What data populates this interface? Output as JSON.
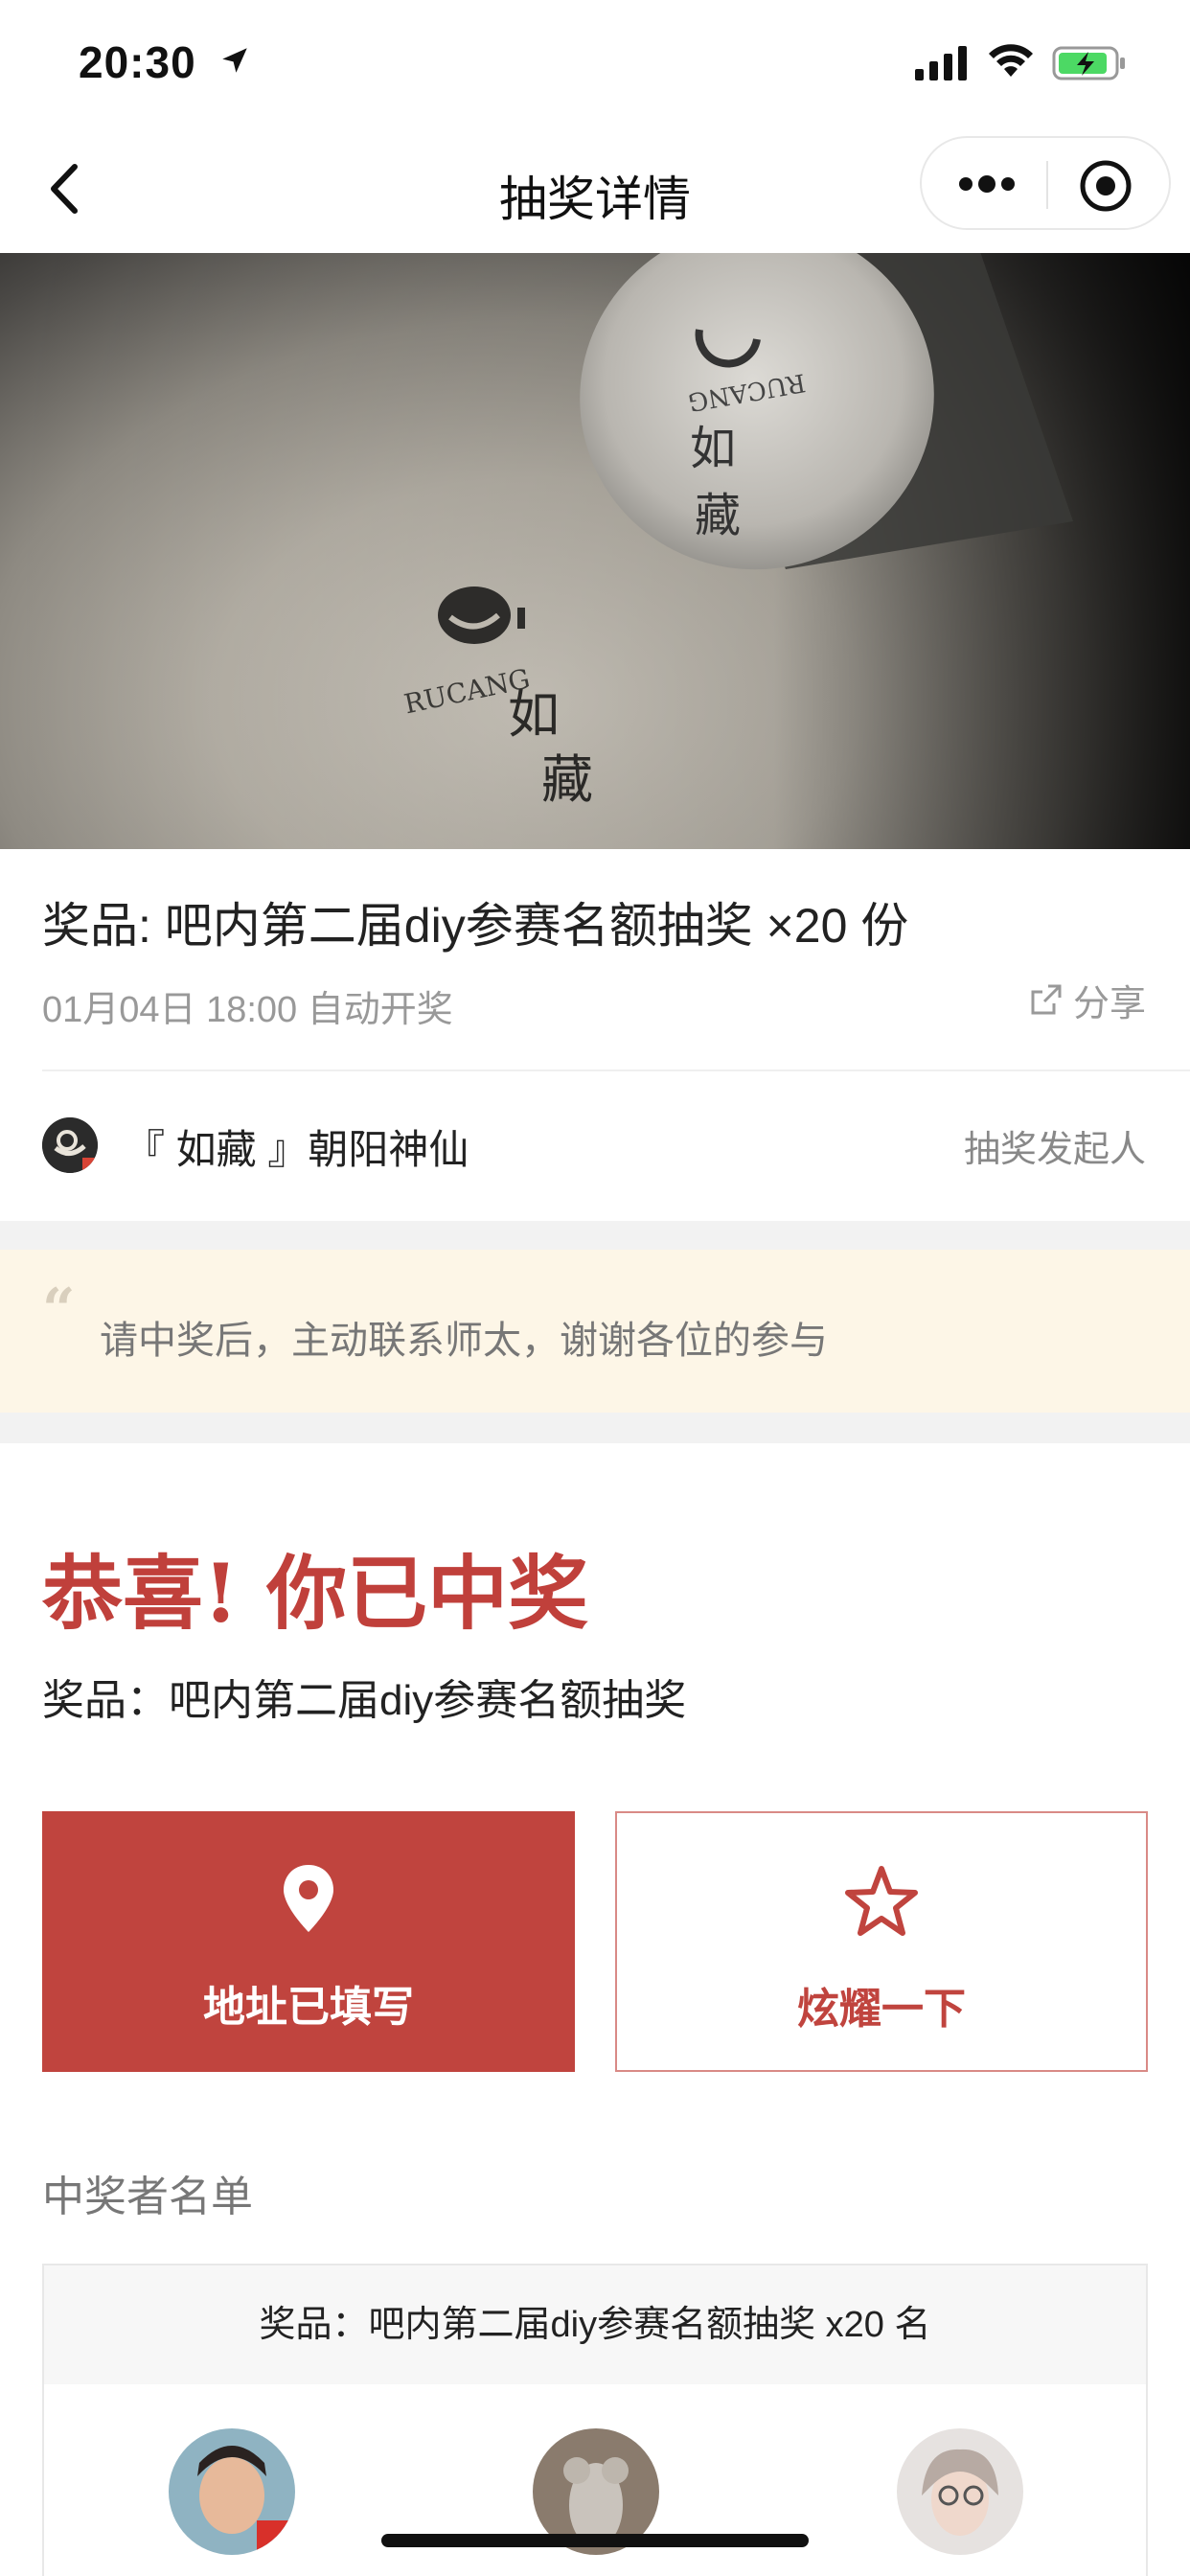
{
  "status_bar": {
    "time": "20:30",
    "icons": [
      "location-arrow-icon",
      "cellular-signal-icon",
      "wifi-icon",
      "battery-charging-icon"
    ]
  },
  "nav": {
    "title": "抽奖详情",
    "back_icon": "chevron-left-icon",
    "more_icon": "more-dots-icon",
    "target_icon": "target-icon"
  },
  "banner": {
    "description_icon": "rucang-seal-photo",
    "brand_text": "RUCANG",
    "brand_cn": "如藏"
  },
  "prize": {
    "title": "奖品: 吧内第二届diy参赛名额抽奖 ×20 份",
    "draw_time": "01月04日 18:00 自动开奖",
    "share_label": "分享"
  },
  "sponsor": {
    "name": "『 如藏 』朝阳神仙",
    "tag": "抽奖发起人"
  },
  "notice": {
    "text": "请中奖后，主动联系师太，谢谢各位的参与"
  },
  "result": {
    "title": "恭喜! 你已中奖",
    "prize_line": "奖品：吧内第二届diy参赛名额抽奖"
  },
  "actions": {
    "address_label": "地址已填写",
    "show_label": "炫耀一下"
  },
  "winners": {
    "heading": "中奖者名单",
    "card_header": "奖品：吧内第二届diy参赛名额抽奖 x20 名"
  },
  "colors": {
    "accent": "#c0443e",
    "notice_bg": "#fdf6e7",
    "muted_text": "#999999"
  }
}
